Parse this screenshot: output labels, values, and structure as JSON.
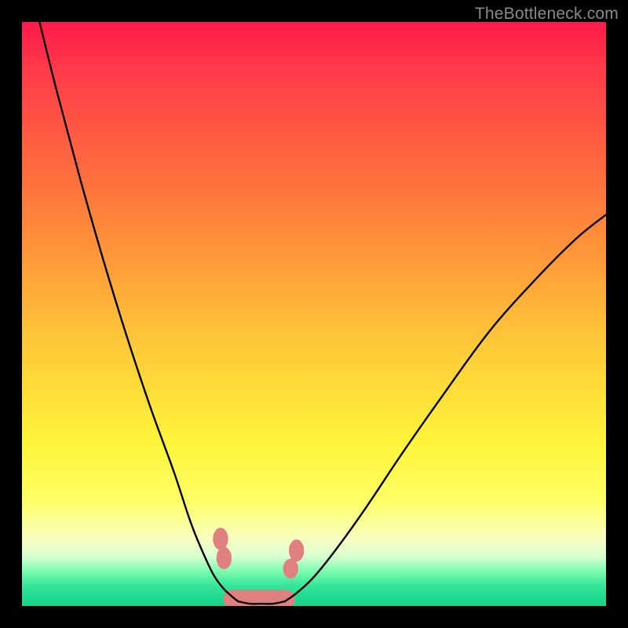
{
  "watermark": "TheBottleneck.com",
  "chart_data": {
    "type": "line",
    "title": "",
    "xlabel": "",
    "ylabel": "",
    "xlim": [
      0,
      100
    ],
    "ylim": [
      0,
      100
    ],
    "series": [
      {
        "name": "left-curve",
        "x": [
          3,
          6,
          10,
          14,
          18,
          22,
          26,
          29,
          31.5,
          33,
          34.5,
          36,
          37
        ],
        "values": [
          100,
          88,
          73,
          59,
          46,
          34,
          23,
          14,
          8,
          5,
          3,
          1.6,
          0.8
        ]
      },
      {
        "name": "right-curve",
        "x": [
          45,
          47,
          50,
          54,
          59,
          65,
          72,
          80,
          88,
          95,
          100
        ],
        "values": [
          0.8,
          2.2,
          5,
          10,
          17,
          26,
          36,
          47,
          56,
          63,
          67
        ]
      },
      {
        "name": "floor",
        "x": [
          37,
          39,
          41,
          43,
          45
        ],
        "values": [
          0.8,
          0.4,
          0.4,
          0.4,
          0.8
        ]
      }
    ],
    "markers": [
      {
        "name": "left-blob-upper",
        "cx": 34.0,
        "cy": 11.5,
        "rx": 1.3,
        "ry": 1.9
      },
      {
        "name": "left-blob-lower",
        "cx": 34.6,
        "cy": 8.2,
        "rx": 1.3,
        "ry": 1.9
      },
      {
        "name": "right-blob-upper",
        "cx": 47.0,
        "cy": 9.5,
        "rx": 1.3,
        "ry": 1.9
      },
      {
        "name": "right-blob-lower",
        "cx": 46.0,
        "cy": 6.4,
        "rx": 1.3,
        "ry": 1.7
      }
    ],
    "trough_capsule": {
      "x1": 36.0,
      "x2": 45.2,
      "y": 1.2,
      "r": 1.55
    },
    "marker_color": "#e08080",
    "curve_color": "#000000",
    "curve_width": 2.4
  }
}
